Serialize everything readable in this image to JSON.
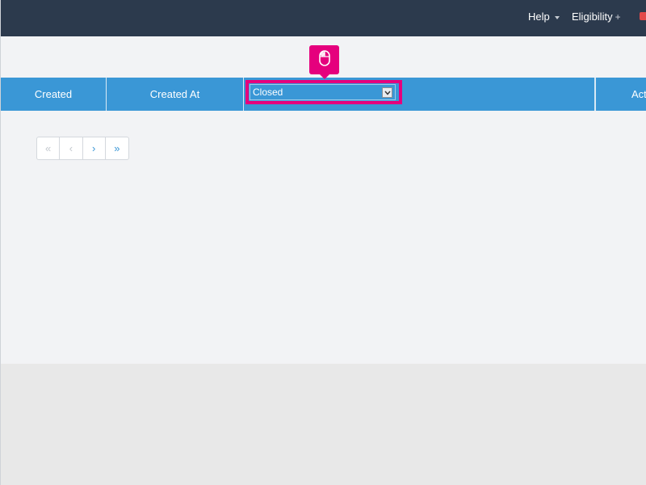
{
  "topbar": {
    "help_label": "Help",
    "eligibility_label": "Eligibility",
    "eligibility_suffix": "+"
  },
  "table": {
    "columns": [
      "Created",
      "Created At",
      "",
      "Act"
    ],
    "status_filter": {
      "selected": "Closed"
    }
  },
  "pagination": {
    "first": "«",
    "prev": "‹",
    "next": "›",
    "last": "»"
  },
  "colors": {
    "topbar_bg": "#2c3a4d",
    "header_bg": "#3a97d6",
    "highlight": "#e5007d",
    "content_bg": "#f2f3f5"
  },
  "icons": {
    "mouse_badge": "mouse-icon",
    "select_arrow": "chevron-down-icon"
  }
}
